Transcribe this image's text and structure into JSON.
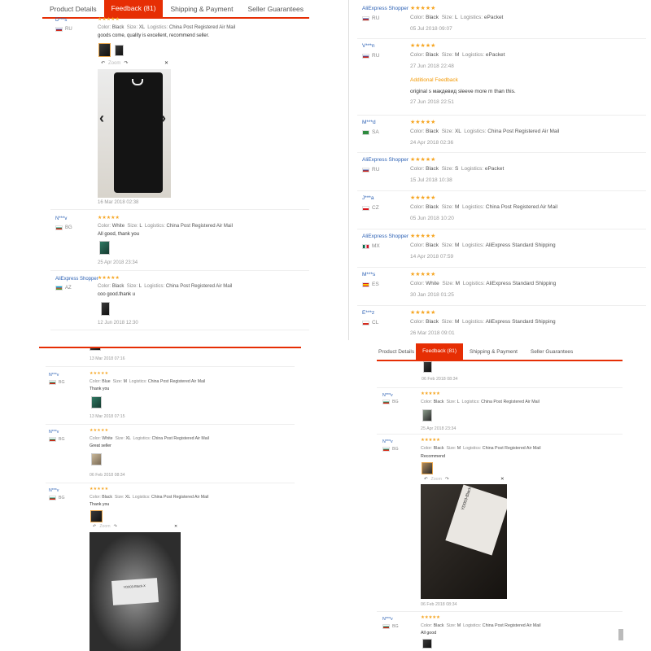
{
  "tabs": [
    "Product Details",
    "Feedback (81)",
    "Shipping & Payment",
    "Seller Guarantees"
  ],
  "labels": {
    "color": "Color:",
    "size": "Size:",
    "logistics": "Logistics:"
  },
  "viewer_zoom_label": "Zoom",
  "panel1": {
    "reviews": [
      {
        "user": "D***s",
        "country": "RU",
        "color": "Black",
        "size": "XL",
        "logistics": "China Post Registered Air Mail",
        "text": "goods come, quality is excellent, recommend seller.",
        "date": "16 Mar 2018 02:38"
      },
      {
        "user": "N***v",
        "country": "BG",
        "color": "White",
        "size": "L",
        "logistics": "China Post Registered Air Mail",
        "text": "All good, thank you",
        "date": "25 Apr 2018 23:34"
      },
      {
        "user": "AliExpress Shopper",
        "country": "AZ",
        "color": "Black",
        "size": "L",
        "logistics": "China Post Registered Air Mail",
        "text": "coo good.thank u",
        "date": "12 Jun 2018 12:30"
      }
    ]
  },
  "panel2": {
    "reviews": [
      {
        "user": "AliExpress Shopper",
        "country": "RU",
        "color": "Black",
        "size": "L",
        "logistics": "ePacket",
        "date": "05 Jul 2018 09:07"
      },
      {
        "user": "V***n",
        "country": "RU",
        "color": "Black",
        "size": "M",
        "logistics": "ePacket",
        "date": "27 Jun 2018 22:48",
        "additional_label": "Additional Feedback",
        "additional_text": "original s макдевид sleeve more m than this.",
        "additional_date": "27 Jun 2018 22:51"
      },
      {
        "user": "M***d",
        "country": "SA",
        "color": "Black",
        "size": "XL",
        "logistics": "China Post Registered Air Mail",
        "date": "24 Apr 2018 02:36"
      },
      {
        "user": "AliExpress Shopper",
        "country": "RU",
        "color": "Black",
        "size": "S",
        "logistics": "ePacket",
        "date": "15 Jul 2018 10:38"
      },
      {
        "user": "J***a",
        "country": "CZ",
        "color": "Black",
        "size": "M",
        "logistics": "China Post Registered Air Mail",
        "date": "05 Jun 2018 10:20"
      },
      {
        "user": "AliExpress Shopper",
        "country": "MX",
        "color": "Black",
        "size": "M",
        "logistics": "AliExpress Standard Shipping",
        "date": "14 Apr 2018 07:59"
      },
      {
        "user": "M***s",
        "country": "ES",
        "color": "White",
        "size": "M",
        "logistics": "AliExpress Standard Shipping",
        "date": "30 Jan 2018 01:25"
      },
      {
        "user": "E***z",
        "country": "CL",
        "color": "Black",
        "size": "M",
        "logistics": "AliExpress Standard Shipping",
        "date": "26 Mar 2018 09:01"
      }
    ]
  },
  "panel3": {
    "top_date": "13 Mar 2018 07:16",
    "reviews": [
      {
        "user": "N***v",
        "country": "BG",
        "color": "Blue",
        "size": "M",
        "logistics": "China Post Registered Air Mail",
        "text": "Thank you",
        "date": "13 Mar 2018 07:15"
      },
      {
        "user": "N***v",
        "country": "BG",
        "color": "White",
        "size": "XL",
        "logistics": "China Post Registered Air Mail",
        "text": "Great seller",
        "date": "06 Feb 2018 08:34"
      },
      {
        "user": "N***v",
        "country": "BG",
        "color": "Black",
        "size": "XL",
        "logistics": "China Post Registered Air Mail",
        "text": "Thank you",
        "photo_label": "YD003-Black-X"
      }
    ]
  },
  "panel4": {
    "top_date": "06 Feb 2018 08:34",
    "reviews": [
      {
        "user": "N***v",
        "country": "BG",
        "color": "Black",
        "size": "L",
        "logistics": "China Post Registered Air Mail",
        "date": "25 Apr 2018 23:34"
      },
      {
        "user": "N***v",
        "country": "BG",
        "color": "Black",
        "size": "M",
        "logistics": "China Post Registered Air Mail",
        "text": "Recommend",
        "date": "06 Feb 2018 08:34",
        "photo_label": "YD003-Black"
      },
      {
        "user": "N***v",
        "country": "BG",
        "color": "Black",
        "size": "M",
        "logistics": "China Post Registered Air Mail",
        "text": "All good"
      }
    ]
  },
  "colors": {
    "accent": "#e62e04",
    "star": "#f6a623",
    "user_link": "#2c61b4",
    "additional": "#f39800"
  }
}
